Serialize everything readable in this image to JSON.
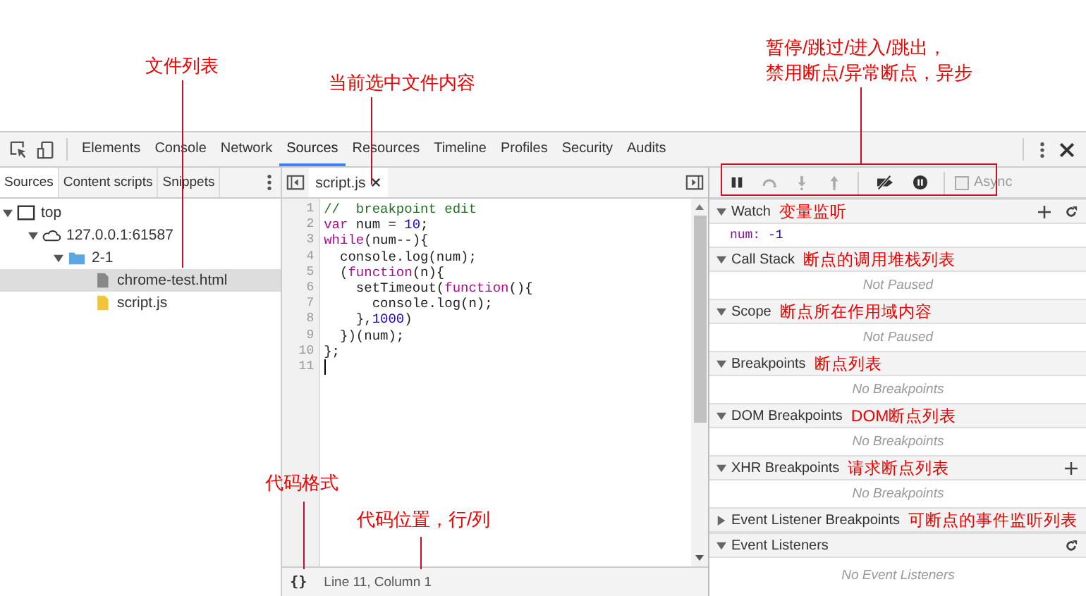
{
  "annotations": {
    "file_list": "文件列表",
    "current_file": "当前选中文件内容",
    "debugger_controls": [
      "暂停/跳过/进入/跳出，",
      "禁用断点/异常断点，异步"
    ],
    "format": "代码格式",
    "position": "代码位置，行/列"
  },
  "panel_tabs": [
    {
      "label": "Elements",
      "selected": false
    },
    {
      "label": "Console",
      "selected": false
    },
    {
      "label": "Network",
      "selected": false
    },
    {
      "label": "Sources",
      "selected": true
    },
    {
      "label": "Resources",
      "selected": false
    },
    {
      "label": "Timeline",
      "selected": false
    },
    {
      "label": "Profiles",
      "selected": false
    },
    {
      "label": "Security",
      "selected": false
    },
    {
      "label": "Audits",
      "selected": false
    }
  ],
  "navigator": {
    "tabs": [
      {
        "label": "Sources",
        "selected": true
      },
      {
        "label": "Content scripts",
        "selected": false
      },
      {
        "label": "Snippets",
        "selected": false
      }
    ],
    "tree": [
      {
        "label": "top",
        "kind": "frame",
        "expanded": true,
        "selected": false,
        "children": [
          {
            "label": "127.0.0.1:61587",
            "kind": "domain",
            "expanded": true,
            "selected": false,
            "children": [
              {
                "label": "2-1",
                "kind": "folder",
                "expanded": true,
                "selected": false,
                "children": [
                  {
                    "label": "chrome-test.html",
                    "kind": "file",
                    "selected": true
                  },
                  {
                    "label": "script.js",
                    "kind": "script",
                    "selected": false
                  }
                ]
              }
            ]
          }
        ]
      }
    ]
  },
  "editor": {
    "tabs": [
      {
        "label": "script.js",
        "selected": true
      }
    ],
    "lines": [
      {
        "number": "1",
        "cursor": false,
        "tokens": [
          {
            "text": "//  breakpoint edit",
            "kind": "comment"
          }
        ]
      },
      {
        "number": "2",
        "cursor": false,
        "tokens": [
          {
            "text": "var",
            "kind": "keyword"
          },
          {
            "text": " num = ",
            "kind": "plain"
          },
          {
            "text": "10",
            "kind": "number"
          },
          {
            "text": ";",
            "kind": "plain"
          }
        ]
      },
      {
        "number": "3",
        "cursor": false,
        "tokens": [
          {
            "text": "while",
            "kind": "keyword"
          },
          {
            "text": "(num--){",
            "kind": "plain"
          }
        ]
      },
      {
        "number": "4",
        "cursor": false,
        "tokens": [
          {
            "text": "  console.log(num);",
            "kind": "plain"
          }
        ]
      },
      {
        "number": "5",
        "cursor": false,
        "tokens": [
          {
            "text": "  (",
            "kind": "plain"
          },
          {
            "text": "function",
            "kind": "keyword"
          },
          {
            "text": "(n){",
            "kind": "plain"
          }
        ]
      },
      {
        "number": "6",
        "cursor": false,
        "tokens": [
          {
            "text": "    setTimeout(",
            "kind": "plain"
          },
          {
            "text": "function",
            "kind": "keyword"
          },
          {
            "text": "(){",
            "kind": "plain"
          }
        ]
      },
      {
        "number": "7",
        "cursor": false,
        "tokens": [
          {
            "text": "      console.log(n);",
            "kind": "plain"
          }
        ]
      },
      {
        "number": "8",
        "cursor": false,
        "tokens": [
          {
            "text": "    },",
            "kind": "plain"
          },
          {
            "text": "1000",
            "kind": "number"
          },
          {
            "text": ")",
            "kind": "plain"
          }
        ]
      },
      {
        "number": "9",
        "cursor": false,
        "tokens": [
          {
            "text": "  })(num);",
            "kind": "plain"
          }
        ]
      },
      {
        "number": "10",
        "cursor": false,
        "tokens": [
          {
            "text": "};",
            "kind": "plain"
          }
        ]
      },
      {
        "number": "11",
        "cursor": true
      }
    ],
    "status": {
      "format_button": "{}",
      "position": "Line 11, Column 1"
    }
  },
  "debugger": {
    "async": {
      "label": "Async",
      "checked": false
    },
    "sections": [
      {
        "title": "Watch",
        "note": "变量监听",
        "expanded": true,
        "add": true,
        "refresh": true,
        "watch": [
          {
            "name": "num:",
            "value": "-1"
          }
        ]
      },
      {
        "title": "Call Stack",
        "note": "断点的调用堆栈列表",
        "expanded": true,
        "add": false,
        "refresh": false,
        "message": "Not Paused"
      },
      {
        "title": "Scope",
        "note": "断点所在作用域内容",
        "expanded": true,
        "add": false,
        "refresh": false,
        "message": "Not Paused"
      },
      {
        "title": "Breakpoints",
        "note": "断点列表",
        "expanded": true,
        "add": false,
        "refresh": false,
        "message": "No Breakpoints"
      },
      {
        "title": "DOM Breakpoints",
        "note": "DOM断点列表",
        "expanded": true,
        "add": false,
        "refresh": false,
        "message": "No Breakpoints"
      },
      {
        "title": "XHR Breakpoints",
        "note": "请求断点列表",
        "expanded": true,
        "add": true,
        "refresh": false,
        "message": "No Breakpoints"
      },
      {
        "title": "Event Listener Breakpoints",
        "note": "可断点的事件监听列表",
        "expanded": false,
        "add": false,
        "refresh": false
      },
      {
        "title": "Event Listeners",
        "expanded": true,
        "add": false,
        "refresh": true,
        "message": "No Event Listeners"
      }
    ]
  }
}
